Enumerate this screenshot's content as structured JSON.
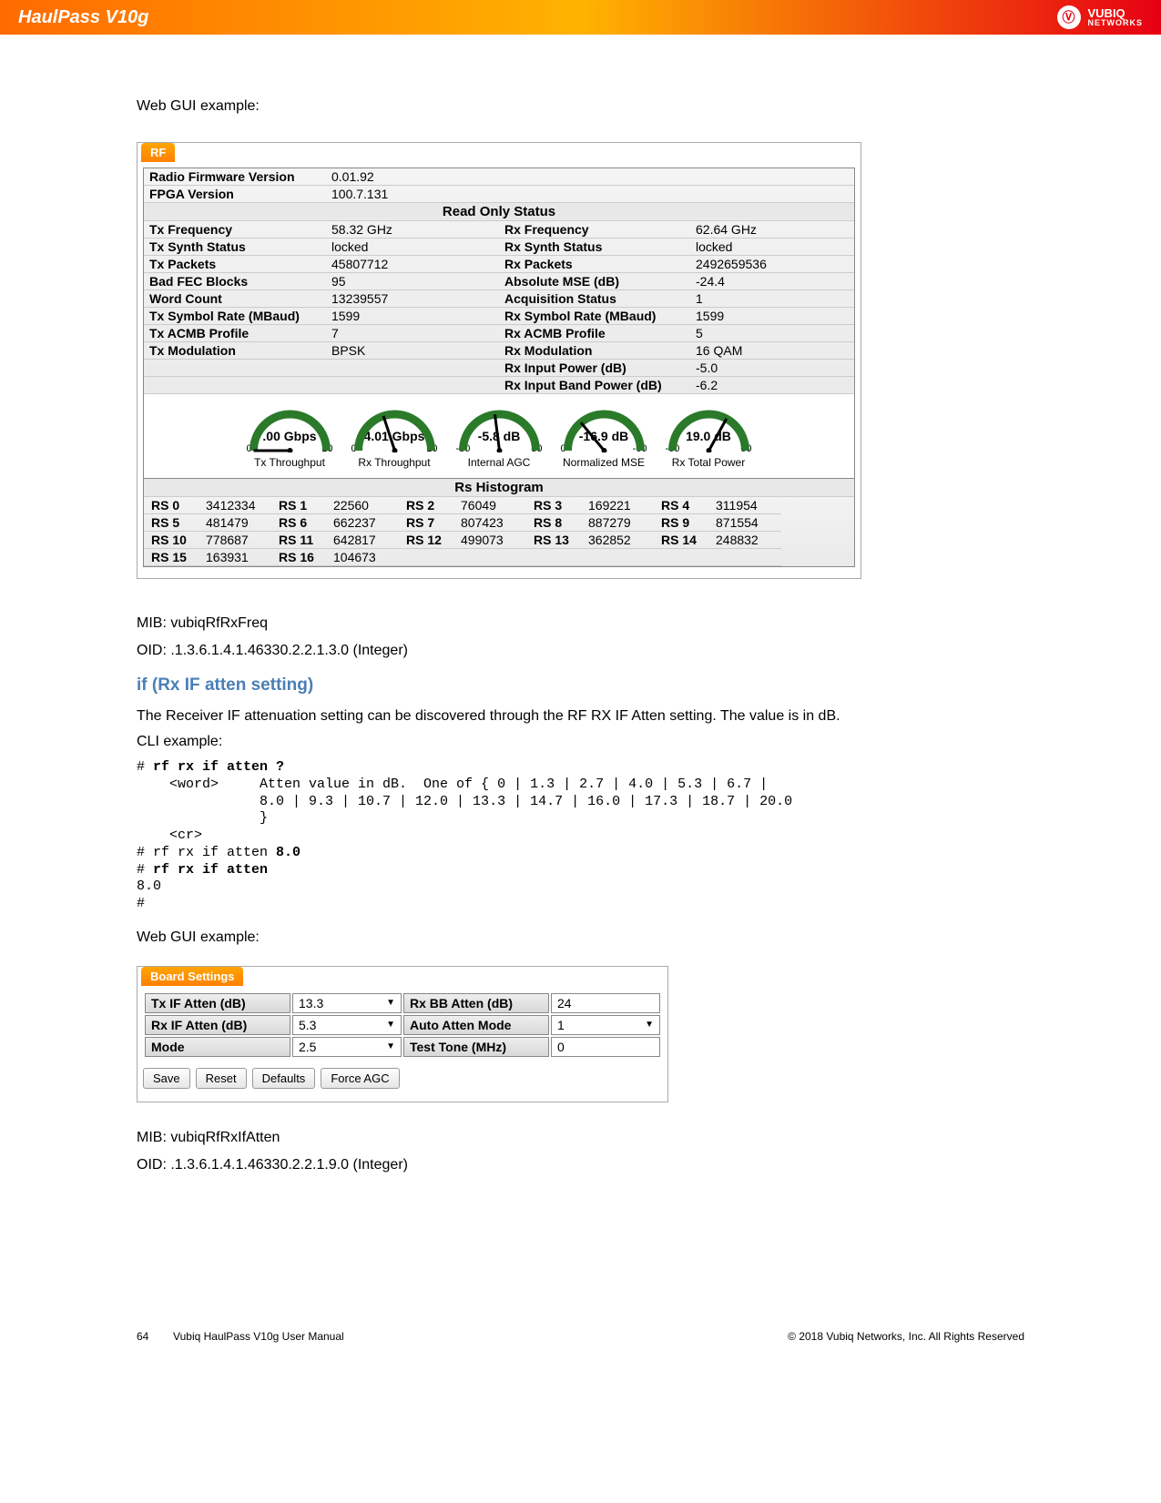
{
  "header": {
    "title": "HaulPass V10g",
    "brand": "VUBIQ",
    "brand2": "NETWORKS"
  },
  "intro1": "Web GUI example:",
  "rf": {
    "tab": "RF",
    "firmware": {
      "label": "Radio Firmware Version",
      "value": "0.01.92"
    },
    "fpga": {
      "label": "FPGA Version",
      "value": "100.7.131"
    },
    "statusHeader": "Read Only Status",
    "leftRows": [
      {
        "l": "Tx Frequency",
        "v": "58.32 GHz"
      },
      {
        "l": "Tx Synth Status",
        "v": "locked"
      },
      {
        "l": "Tx Packets",
        "v": "45807712"
      },
      {
        "l": "Bad FEC Blocks",
        "v": "95"
      },
      {
        "l": "Word Count",
        "v": "13239557"
      },
      {
        "l": "Tx Symbol Rate (MBaud)",
        "v": "1599"
      },
      {
        "l": "Tx ACMB Profile",
        "v": "7"
      },
      {
        "l": "Tx Modulation",
        "v": "BPSK"
      }
    ],
    "rightRows": [
      {
        "l": "Rx Frequency",
        "v": "62.64 GHz"
      },
      {
        "l": "Rx Synth Status",
        "v": "locked"
      },
      {
        "l": "Rx Packets",
        "v": "2492659536"
      },
      {
        "l": "Absolute MSE (dB)",
        "v": "-24.4"
      },
      {
        "l": "Acquisition Status",
        "v": "1"
      },
      {
        "l": "Rx Symbol Rate (MBaud)",
        "v": "1599"
      },
      {
        "l": "Rx ACMB Profile",
        "v": "5"
      },
      {
        "l": "Rx Modulation",
        "v": "16 QAM"
      },
      {
        "l": "Rx Input Power (dB)",
        "v": "-5.0"
      },
      {
        "l": "Rx Input Band Power (dB)",
        "v": "-6.2"
      }
    ],
    "gauges": [
      {
        "val": ".00 Gbps",
        "lo": "0",
        "hi": "10",
        "label": "Tx Throughput",
        "frac": 0.0
      },
      {
        "val": "4.01 Gbps",
        "lo": "0",
        "hi": "10",
        "label": "Rx Throughput",
        "frac": 0.4
      },
      {
        "val": "-5.8 dB",
        "lo": "-80",
        "hi": "80",
        "label": "Internal AGC",
        "frac": 0.46
      },
      {
        "val": "-16.9 dB",
        "lo": "0",
        "hi": "-60",
        "label": "Normalized MSE",
        "frac": 0.28
      },
      {
        "val": "19.0 dB",
        "lo": "-60",
        "hi": "60",
        "label": "Rx Total Power",
        "frac": 0.66
      }
    ],
    "histHeader": "Rs Histogram",
    "hist": [
      [
        "RS 0",
        "3412334",
        "RS 1",
        "22560",
        "RS 2",
        "76049",
        "RS 3",
        "169221",
        "RS 4",
        "311954"
      ],
      [
        "RS 5",
        "481479",
        "RS 6",
        "662237",
        "RS 7",
        "807423",
        "RS 8",
        "887279",
        "RS 9",
        "871554"
      ],
      [
        "RS 10",
        "778687",
        "RS 11",
        "642817",
        "RS 12",
        "499073",
        "RS 13",
        "362852",
        "RS 14",
        "248832"
      ],
      [
        "RS 15",
        "163931",
        "RS 16",
        "104673"
      ]
    ]
  },
  "mib1": {
    "mib": "MIB:  vubiqRfRxFreq",
    "oid": "OID:  .1.3.6.1.4.1.46330.2.2.1.3.0 (Integer)"
  },
  "sec": {
    "title": "if (Rx IF atten setting)",
    "desc": "The Receiver IF attenuation setting can be discovered through the RF RX IF Atten setting.  The value is in dB.",
    "cliLabel": "CLI example:"
  },
  "cli": {
    "l1a": "# ",
    "l1b": "rf rx if atten ?",
    "l2": "    <word>     Atten value in dB.  One of { 0 | 1.3 | 2.7 | 4.0 | 5.3 | 6.7 |",
    "l3": "               8.0 | 9.3 | 10.7 | 12.0 | 13.3 | 14.7 | 16.0 | 17.3 | 18.7 | 20.0",
    "l4": "               }",
    "l5": "    <cr>",
    "l6a": "# rf rx if atten ",
    "l6b": "8.0",
    "l7a": "# ",
    "l7b": "rf rx if atten",
    "l8": "8.0",
    "l9": "#"
  },
  "intro2": "Web GUI example:",
  "board": {
    "tab": "Board Settings",
    "rows": [
      {
        "l1": "Tx IF Atten (dB)",
        "v1": "13.3",
        "dd1": true,
        "l2": "Rx BB Atten (dB)",
        "v2": "24",
        "dd2": false
      },
      {
        "l1": "Rx IF Atten (dB)",
        "v1": "5.3",
        "dd1": true,
        "l2": "Auto Atten Mode",
        "v2": "1",
        "dd2": true
      },
      {
        "l1": "Mode",
        "v1": "2.5",
        "dd1": true,
        "l2": "Test Tone (MHz)",
        "v2": "0",
        "dd2": false
      }
    ],
    "buttons": [
      "Save",
      "Reset",
      "Defaults",
      "Force AGC"
    ]
  },
  "mib2": {
    "mib": "MIB:  vubiqRfRxIfAtten",
    "oid": "OID:  .1.3.6.1.4.1.46330.2.2.1.9.0 (Integer)"
  },
  "footer": {
    "page": "64",
    "center": "Vubiq HaulPass V10g User Manual",
    "right": "© 2018 Vubiq Networks, Inc. All Rights Reserved"
  }
}
